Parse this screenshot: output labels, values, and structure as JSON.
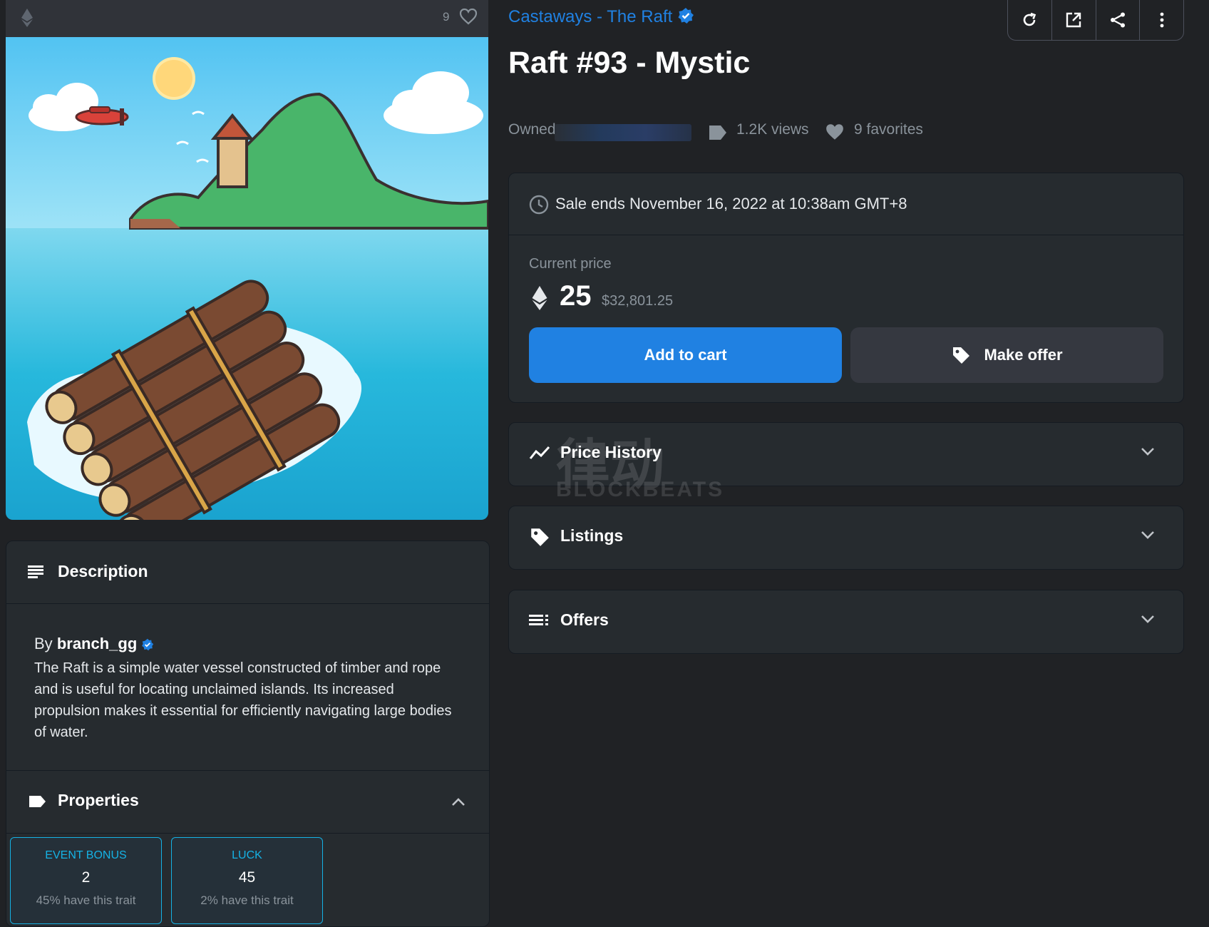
{
  "image_header": {
    "favorites_count": "9"
  },
  "collection": {
    "name": "Castaways - The Raft"
  },
  "item": {
    "title": "Raft #93 - Mystic"
  },
  "stats": {
    "owner_label": "Owned",
    "views": "1.2K views",
    "favorites": "9 favorites"
  },
  "sale": {
    "ends": "Sale ends November 16, 2022 at 10:38am GMT+8",
    "price_label": "Current price",
    "price": "25",
    "price_usd": "$32,801.25",
    "add_to_cart": "Add to cart",
    "make_offer": "Make offer"
  },
  "accordions": [
    {
      "title": "Price History"
    },
    {
      "title": "Listings"
    },
    {
      "title": "Offers"
    }
  ],
  "description": {
    "title": "Description",
    "by": "By",
    "creator": "branch_gg",
    "text": "The Raft is a simple water vessel constructed of timber and rope and is useful for locating unclaimed islands. Its increased propulsion makes it essential for efficiently navigating large bodies of water."
  },
  "properties": {
    "title": "Properties",
    "traits": [
      {
        "type": "EVENT BONUS",
        "value": "2",
        "rarity": "45% have this trait"
      },
      {
        "type": "LUCK",
        "value": "45",
        "rarity": "2% have this trait"
      }
    ]
  },
  "watermark": {
    "cn": "律动",
    "en": "BLOCKBEATS"
  },
  "colors": {
    "accent": "#2081e2",
    "background": "#202225",
    "panel": "#262b2f",
    "trait_border": "#15b2e5"
  }
}
